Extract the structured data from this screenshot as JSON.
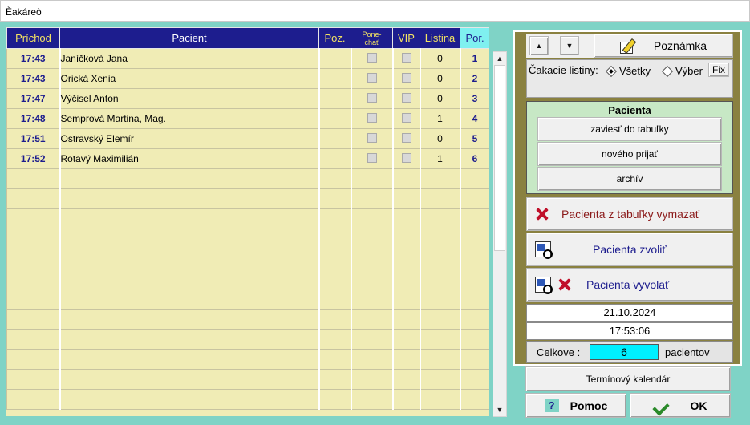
{
  "window": {
    "title": "Èakáreò"
  },
  "table": {
    "headers": {
      "prichod": "Príchod",
      "pacient": "Pacient",
      "poz": "Poz.",
      "ponechat_1": "Pone-",
      "ponechat_2": "chať",
      "vip": "VIP",
      "listina": "Listina",
      "por": "Por."
    },
    "rows": [
      {
        "time": "17:43",
        "name": "Janíčková Jana",
        "listina": "0",
        "por": "1"
      },
      {
        "time": "17:43",
        "name": "Orická Xenia",
        "listina": "0",
        "por": "2"
      },
      {
        "time": "17:47",
        "name": "Výčisel Anton",
        "listina": "0",
        "por": "3"
      },
      {
        "time": "17:48",
        "name": "Semprová Martina, Mag.",
        "listina": "1",
        "por": "4"
      },
      {
        "time": "17:51",
        "name": "Ostravský Elemír",
        "listina": "0",
        "por": "5"
      },
      {
        "time": "17:52",
        "name": "Rotavý Maximilián",
        "listina": "1",
        "por": "6"
      }
    ]
  },
  "panel": {
    "note_label": "Poznámka",
    "lists_label": "Čakacie listiny:",
    "radio_all": "Všetky",
    "radio_select": "Výber",
    "fix_label": "Fix",
    "pacienta_title": "Pacienta",
    "btn_add_table": "zaviesť do tabuľky",
    "btn_new": "nového prijať",
    "btn_archive": "archív",
    "btn_delete": "Pacienta z tabuľky vymazať",
    "btn_select": "Pacienta zvoliť",
    "btn_call": "Pacienta vyvolať",
    "date": "21.10.2024",
    "time": "17:53:06",
    "total_label": "Celkove :",
    "total_value": "6",
    "total_unit": "pacientov"
  },
  "footer": {
    "calendar": "Termínový kalendár",
    "help": "Pomoc",
    "ok": "OK"
  },
  "colors": {
    "header_bg": "#1d1d8e",
    "header_text": "#f4e463",
    "row_bg": "#f0ecb5",
    "panel_bg": "#8a8140",
    "window_bg": "#7fd3c6",
    "delete_text": "#8b1a1a",
    "action_text": "#1d1d8e",
    "total_bg": "#00f0ff"
  }
}
